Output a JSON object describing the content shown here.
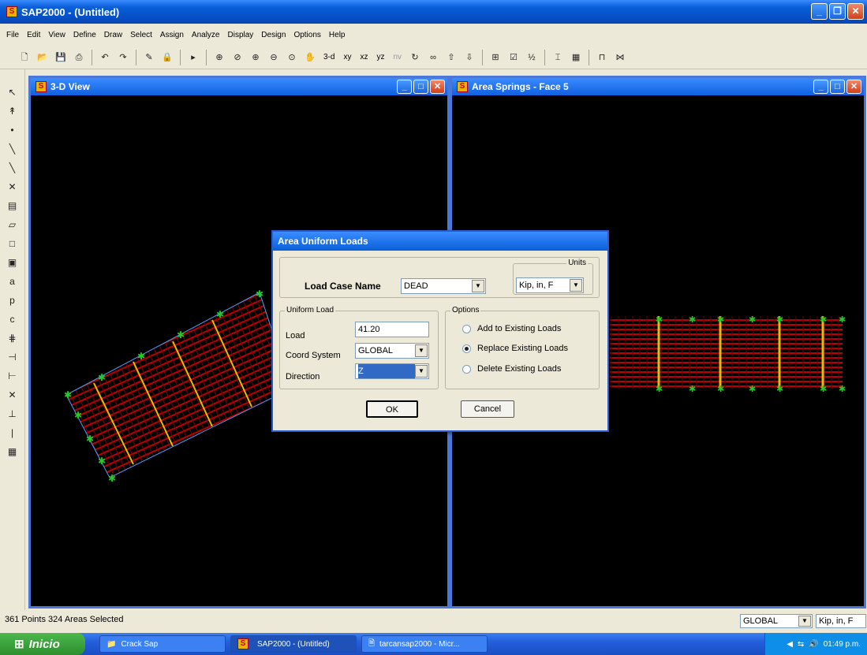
{
  "window": {
    "title": "SAP2000 - (Untitled)",
    "app_icon": "sap2000-icon"
  },
  "menu": [
    "File",
    "Edit",
    "View",
    "Define",
    "Draw",
    "Select",
    "Assign",
    "Analyze",
    "Display",
    "Design",
    "Options",
    "Help"
  ],
  "toolbar": {
    "view_3d": "3-d",
    "view_xy": "xy",
    "view_xz": "xz",
    "view_yz": "yz",
    "view_nv": "nv"
  },
  "panes": {
    "left": {
      "title": "3-D View"
    },
    "right": {
      "title": "Area Springs - Face 5"
    }
  },
  "dialog": {
    "title": "Area Uniform Loads",
    "load_case_label": "Load Case Name",
    "load_case_value": "DEAD",
    "units_group": "Units",
    "units_value": "Kip, in, F",
    "uniform_group": "Uniform Load",
    "load_label": "Load",
    "load_value": "41.20",
    "coord_label": "Coord System",
    "coord_value": "GLOBAL",
    "direction_label": "Direction",
    "direction_value": "Z",
    "options_group": "Options",
    "opt_add": "Add to Existing Loads",
    "opt_replace": "Replace Existing Loads",
    "opt_delete": "Delete Existing Loads",
    "selected_option": "Replace Existing Loads",
    "ok": "OK",
    "cancel": "Cancel"
  },
  "status": {
    "text": "361 Points 324 Areas Selected",
    "coord": "GLOBAL",
    "units": "Kip, in, F"
  },
  "taskbar": {
    "start": "Inicio",
    "tasks": [
      "Crack Sap",
      "SAP2000 - (Untitled)",
      "tarcansap2000 - Micr..."
    ],
    "clock": "01:49 p.m."
  },
  "colors": {
    "titlebar": "#0a5fd8",
    "model_mesh": "#c00000",
    "supports": "#22cc22",
    "frame": "#e0c000"
  }
}
